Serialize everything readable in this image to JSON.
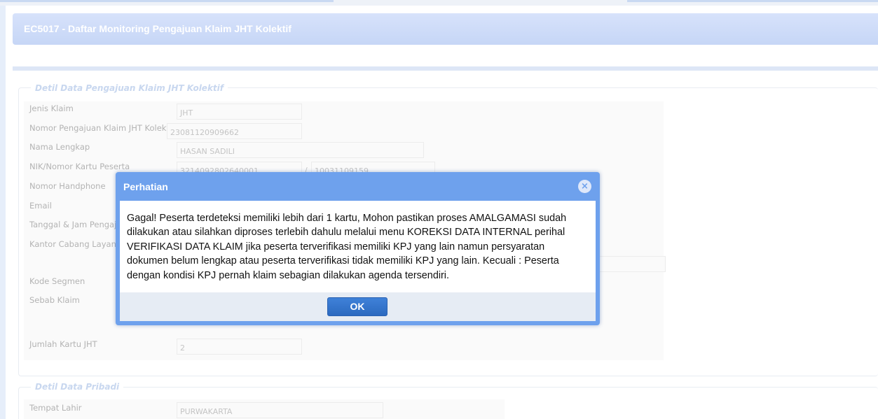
{
  "page_title": "EC5017 - Daftar Monitoring Pengajuan Klaim JHT Kolektif",
  "section_claim": {
    "legend": "Detil Data Pengajuan Klaim JHT Kolektif",
    "labels": {
      "jenis_klaim": "Jenis Klaim",
      "nomor_pengajuan": "Nomor Pengajuan Klaim JHT Kolektif",
      "nama_lengkap": "Nama Lengkap",
      "nik": "NIK/Nomor Kartu Peserta",
      "handphone": "Nomor Handphone",
      "email": "Email",
      "tanggal_jam": "Tanggal & Jam Pengajuan",
      "kantor_cabang": "Kantor Cabang Layanan",
      "kode_segmen": "Kode Segmen",
      "sebab_klaim": "Sebab Klaim",
      "jumlah_kartu": "Jumlah Kartu JHT"
    },
    "values": {
      "jenis_klaim": "JHT",
      "nomor_pengajuan": "23081120909662",
      "nama_lengkap": "HASAN SADILI",
      "nik": "3214092802640001",
      "nik_separator": "/",
      "nomor_kartu": "10031109159",
      "jumlah_kartu": "2"
    }
  },
  "section_personal": {
    "legend": "Detil Data Pribadi",
    "labels": {
      "tempat_lahir": "Tempat Lahir"
    },
    "values": {
      "tempat_lahir": "PURWAKARTA"
    }
  },
  "dialog": {
    "title": "Perhatian",
    "close_icon": "close-icon",
    "message": "Gagal! Peserta terdeteksi memiliki lebih dari 1 kartu, Mohon pastikan proses AMALGAMASI sudah dilakukan atau silahkan diproses terlebih dahulu melalui menu KOREKSI DATA INTERNAL perihal VERIFIKASI DATA KLAIM jika peserta terverifikasi memiliki KPJ yang lain namun persyaratan dokumen belum lengkap atau peserta terverifikasi tidak memiliki KPJ yang lain. Kecuali : Peserta dengan kondisi KPJ pernah klaim sebagian dilakukan agenda tersendiri.",
    "ok_label": "OK"
  },
  "colors": {
    "dialog_header": "#6ea1ed",
    "ok_button": "#3178d0",
    "title_bar": "#cfdcf8"
  }
}
